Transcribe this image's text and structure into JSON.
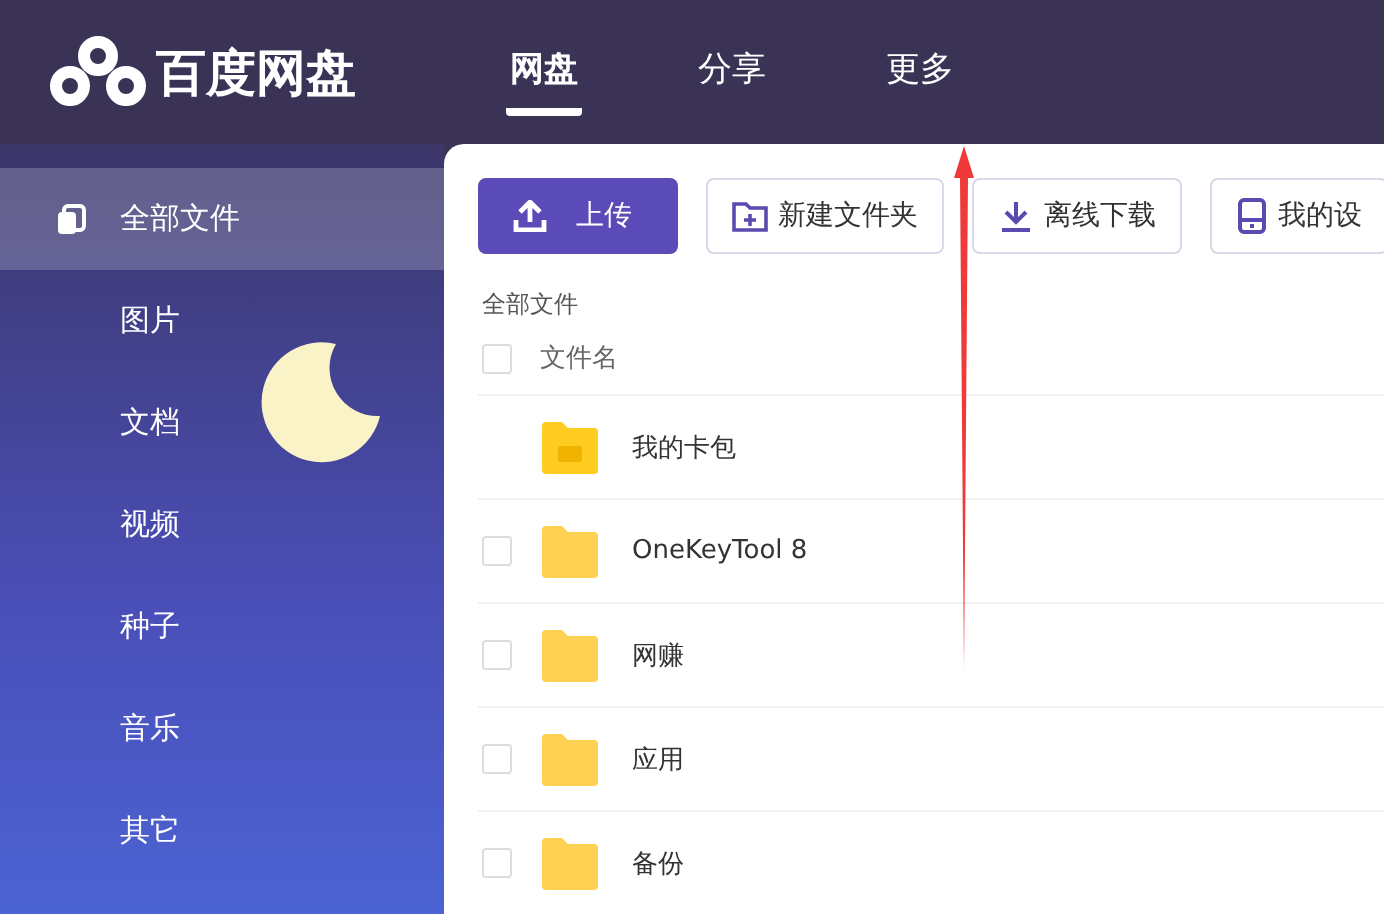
{
  "header": {
    "logo": "百度网盘",
    "tabs": [
      {
        "label": "网盘",
        "selected": true
      },
      {
        "label": "分享",
        "selected": false
      },
      {
        "label": "更多",
        "selected": false
      }
    ]
  },
  "sidebar": {
    "items": [
      {
        "label": "全部文件",
        "selected": true
      },
      {
        "label": "图片",
        "selected": false
      },
      {
        "label": "文档",
        "selected": false
      },
      {
        "label": "视频",
        "selected": false
      },
      {
        "label": "种子",
        "selected": false
      },
      {
        "label": "音乐",
        "selected": false
      },
      {
        "label": "其它",
        "selected": false
      }
    ]
  },
  "toolbar": [
    {
      "label": "上传",
      "kind": "upload"
    },
    {
      "label": "新建文件夹",
      "kind": "new-folder"
    },
    {
      "label": "离线下载",
      "kind": "download"
    },
    {
      "label": "我的设",
      "kind": "device"
    }
  ],
  "breadcrumb": "全部文件",
  "table": {
    "column": "文件名",
    "all_checked": false,
    "rows": [
      {
        "name": "我的卡包",
        "kind": "card"
      },
      {
        "name": "OneKeyTool 8",
        "kind": "folder",
        "checked": false
      },
      {
        "name": "网赚",
        "kind": "folder",
        "checked": false
      },
      {
        "name": "应用",
        "kind": "folder",
        "checked": false
      },
      {
        "name": "备份",
        "kind": "folder",
        "checked": false
      }
    ]
  }
}
